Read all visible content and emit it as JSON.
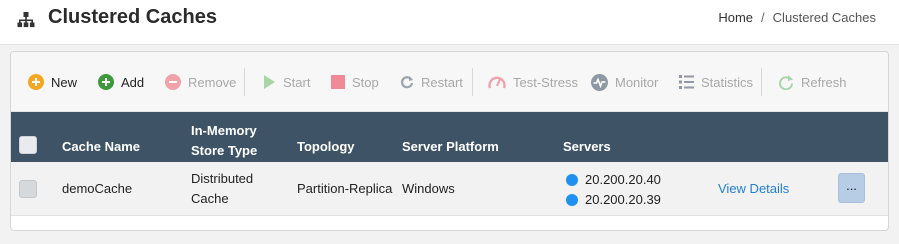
{
  "header": {
    "title": "Clustered Caches",
    "breadcrumb": {
      "home": "Home",
      "separator": "/",
      "current": "Clustered Caches"
    }
  },
  "toolbar": {
    "new": "New",
    "add": "Add",
    "remove": "Remove",
    "start": "Start",
    "stop": "Stop",
    "restart": "Restart",
    "test_stress": "Test-Stress",
    "monitor": "Monitor",
    "statistics": "Statistics",
    "refresh": "Refresh"
  },
  "table": {
    "columns": {
      "cache_name": "Cache Name",
      "store_type": "In-Memory Store Type",
      "store_type_line1": "In-Memory",
      "store_type_line2": "Store Type",
      "topology": "Topology",
      "server_platform": "Server Platform",
      "servers": "Servers"
    },
    "rows": [
      {
        "cache_name": "demoCache",
        "store_type_line1": "Distributed",
        "store_type_line2": "Cache",
        "topology": "Partition-Replica",
        "server_platform": "Windows",
        "servers": [
          "20.200.20.40",
          "20.200.20.39"
        ],
        "details_link": "View Details",
        "more_button": "..."
      }
    ]
  },
  "colors": {
    "header_bg": "#3e5466",
    "accent_link": "#1e7fd8",
    "server_dot": "#1f8ff0",
    "new_icon": "#f5a623",
    "add_icon": "#3c9a3c",
    "remove_icon": "#f1a1a8"
  },
  "icons": {
    "page": "sitemap-icon",
    "new": "plus-circle-icon",
    "add": "plus-circle-icon",
    "remove": "minus-circle-icon",
    "start": "play-icon",
    "stop": "stop-icon",
    "restart": "restart-icon",
    "test_stress": "gauge-icon",
    "monitor": "pulse-icon",
    "statistics": "list-icon",
    "refresh": "refresh-icon"
  }
}
